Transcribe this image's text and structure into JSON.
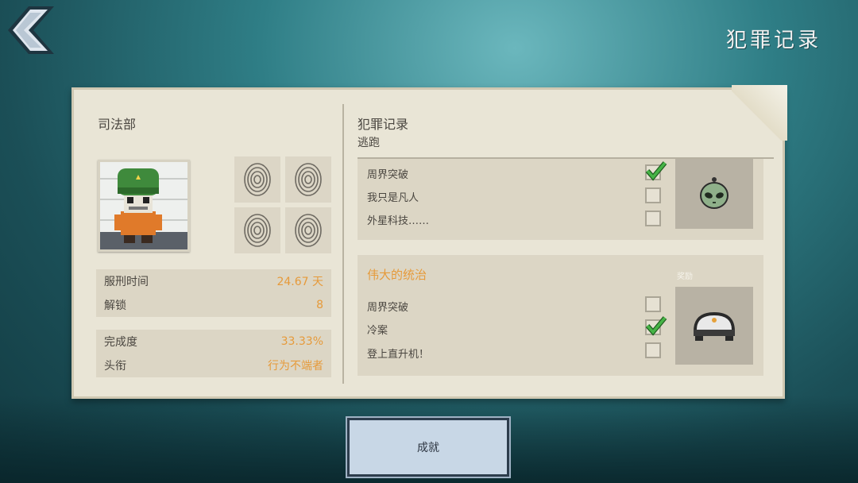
{
  "title": "犯罪记录",
  "left": {
    "title": "司法部",
    "stats_top": [
      {
        "label": "服刑时间",
        "value": "24.67 天"
      },
      {
        "label": "解锁",
        "value": "8"
      }
    ],
    "stats_bottom": [
      {
        "label": "完成度",
        "value": "33.33%"
      },
      {
        "label": "头衔",
        "value": "行为不端者"
      }
    ]
  },
  "right": {
    "title": "犯罪记录",
    "subtitle": "逃跑",
    "card1": {
      "items": [
        {
          "label": "周界突破",
          "checked": true
        },
        {
          "label": "我只是凡人",
          "checked": false
        },
        {
          "label": "外星科技……",
          "checked": false
        }
      ],
      "reward_icon": "alien-head-icon"
    },
    "card2": {
      "title": "伟大的统治",
      "reward_label": "奖励",
      "items": [
        {
          "label": "周界突破",
          "checked": false
        },
        {
          "label": "冷案",
          "checked": true
        },
        {
          "label": "登上直升机！",
          "checked": false
        }
      ],
      "reward_icon": "police-helmet-icon"
    }
  },
  "achievements_button": "成就",
  "colors": {
    "accent": "#e69a3a",
    "paper": "#e9e5d6",
    "panel": "#dcd6c5",
    "check": "#3aa83a"
  }
}
